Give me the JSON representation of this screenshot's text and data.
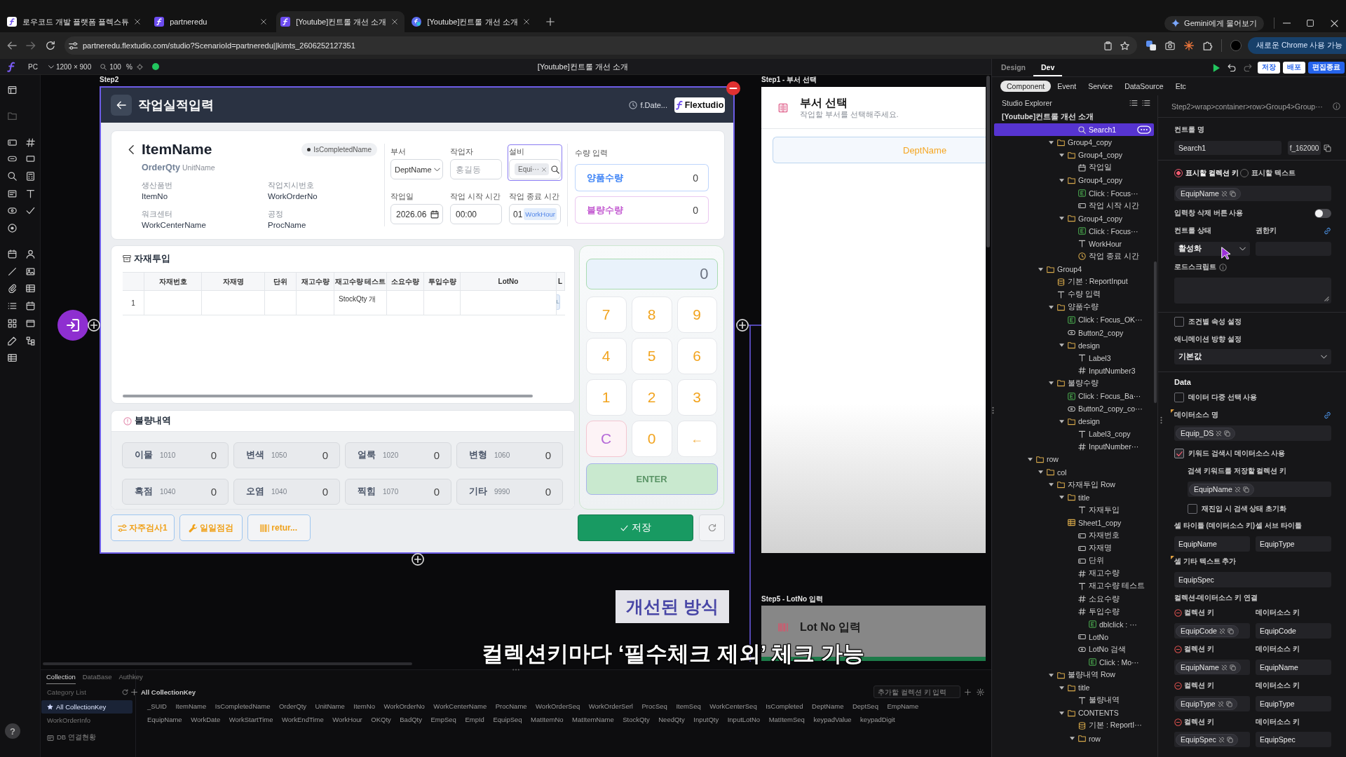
{
  "browser": {
    "tabs": [
      {
        "title": "로우코드 개발 플랫폼 플렉스튜",
        "selected": false
      },
      {
        "title": "partneredu",
        "selected": false
      },
      {
        "title": "[Youtube]컨트롤 개선 소개",
        "selected": true
      },
      {
        "title": "[Youtube]컨트롤 개선 소개",
        "selected": false
      }
    ],
    "assistant_button": "Gemini에게 물어보기",
    "url": "partneredu.flextudio.com/studio?ScenarioId=partneredu||kimts_2606252127351",
    "update_button": "새로운 Chrome 사용 가능"
  },
  "studio_toolbar": {
    "device": "PC",
    "resolution": "1200 × 900",
    "zoom": "100",
    "zoom_unit": "%",
    "title": "[Youtube]컨트롤 개선 소개"
  },
  "canvas": {
    "step2": {
      "label": "Step2",
      "header": {
        "title": "작업실적입력",
        "date": "f.Date...",
        "brand": "Flextudio"
      },
      "item": {
        "name": "ItemName",
        "quantity": "OrderQty",
        "unit": "UnitName",
        "status": "IsCompletedName",
        "details": [
          {
            "label": "생산품번",
            "value": "ItemNo"
          },
          {
            "label": "작업지시번호",
            "value": "WorkOrderNo"
          },
          {
            "label": "워크센터",
            "value": "WorkCenterName"
          },
          {
            "label": "공정",
            "value": "ProcName"
          }
        ]
      },
      "fields": [
        {
          "label": "부서",
          "kind": "select",
          "value": "DeptName",
          "selected": false
        },
        {
          "label": "작업자",
          "kind": "text",
          "placeholder": "홍길동",
          "selected": false
        },
        {
          "label": "설비",
          "kind": "search",
          "chip": "Equi···",
          "selected": true
        },
        {
          "label": "작업일",
          "kind": "date",
          "value": "2026.06",
          "selected": false
        },
        {
          "label": "작업 시작 시간",
          "kind": "text",
          "value": "00:00",
          "selected": false
        },
        {
          "label": "작업 종료 시간",
          "kind": "time",
          "value": "01",
          "tag": "WorkHour",
          "selected": false
        }
      ],
      "quantity": {
        "title": "수량 입력",
        "items": [
          {
            "label": "양품수량",
            "value": "0",
            "color": "#3b82f6"
          },
          {
            "label": "불량수량",
            "value": "0",
            "color": "#c35bd1"
          }
        ]
      },
      "materials": {
        "title": "자재투입",
        "columns": [
          "자재번호",
          "자재명",
          "단위",
          "재고수량",
          "재고수량 테스트",
          "소요수량",
          "투입수량",
          "LotNo",
          "L"
        ],
        "rows": [
          {
            "number": "1",
            "stock_test": "StockQty 개",
            "lot_search": "L"
          }
        ]
      },
      "defects": {
        "title": "불량내역",
        "items": [
          {
            "name": "이물",
            "code": "1010",
            "value": "0"
          },
          {
            "name": "변색",
            "code": "1050",
            "value": "0"
          },
          {
            "name": "얼룩",
            "code": "1020",
            "value": "0"
          },
          {
            "name": "변형",
            "code": "1060",
            "value": "0"
          },
          {
            "name": "흑점",
            "code": "1040",
            "value": "0"
          },
          {
            "name": "오염",
            "code": "1040",
            "value": "0"
          },
          {
            "name": "찍힘",
            "code": "1070",
            "value": "0"
          },
          {
            "name": "기타",
            "code": "9990",
            "value": "0"
          }
        ]
      },
      "keypad": {
        "display": "0",
        "keys": [
          {
            "label": "7",
            "kind": "digit"
          },
          {
            "label": "8",
            "kind": "digit"
          },
          {
            "label": "9",
            "kind": "digit"
          },
          {
            "label": "4",
            "kind": "digit"
          },
          {
            "label": "5",
            "kind": "digit"
          },
          {
            "label": "6",
            "kind": "digit"
          },
          {
            "label": "1",
            "kind": "digit"
          },
          {
            "label": "2",
            "kind": "digit"
          },
          {
            "label": "3",
            "kind": "digit"
          },
          {
            "label": "C",
            "kind": "clear"
          },
          {
            "label": "0",
            "kind": "digit"
          },
          {
            "label": "←",
            "kind": "backspace"
          }
        ],
        "enter": {
          "label": "ENTER",
          "disabled": true
        }
      },
      "actions": [
        {
          "label": "자주검사1",
          "kind": "inspection"
        },
        {
          "label": "일일점검",
          "kind": "maintenance"
        },
        {
          "label": "retur...",
          "kind": "barcode"
        }
      ],
      "save_button": "저장"
    },
    "step1": {
      "label": "Step1 - 부서 선택",
      "title": "부서 선택",
      "subtitle": "작업할 부서를 선택해주세요.",
      "option": "DeptName"
    },
    "step5": {
      "label": "Step5 - LotNo 입력",
      "title": "Lot No 입력"
    },
    "caption": {
      "tag": "개선된 방식",
      "text": "컬렉션키마다 ‘필수체크 제외’ 체크 가능"
    }
  },
  "bottom_panel": {
    "tabs": [
      {
        "label": "Collection",
        "selected": true
      },
      {
        "label": "DataBase",
        "selected": false
      },
      {
        "label": "Authkey",
        "selected": false
      }
    ],
    "category_placeholder": "Category List",
    "categories": [
      {
        "label": "All CollectionKey",
        "kind": "all",
        "selected": true
      },
      {
        "label": "WorkOrderInfo",
        "kind": "group",
        "selected": false
      }
    ],
    "db_status": "DB 연결현황",
    "heading": "All CollectionKey",
    "key_placeholder": "추가할 컬렉션 키 입력",
    "key_rows": [
      [
        "_SUID",
        "ItemName",
        "IsCompletedName",
        "OrderQty",
        "UnitName",
        "ItemNo",
        "WorkOrderNo",
        "WorkCenterName",
        "ProcName",
        "WorkOrderSeq",
        "WorkOrderSerl",
        "ProcSeq",
        "ItemSeq",
        "WorkCenterSeq",
        "IsCompleted",
        "DeptName",
        "DeptSeq",
        "EmpName"
      ],
      [
        "EquipName",
        "WorkDate",
        "WorkStartTime",
        "WorkEndTime",
        "WorkHour",
        "OKQty",
        "BadQty",
        "EmpSeq",
        "EmpId",
        "EquipSeq",
        "MatItemNo",
        "MatItemName",
        "StockQty",
        "NeedQty",
        "InputQty",
        "InputLotNo",
        "MatItemSeq",
        "keypadValue",
        "keypadDigit"
      ]
    ]
  },
  "help_button": "?",
  "right_panel": {
    "mode_tabs": [
      {
        "label": "Design",
        "selected": false
      },
      {
        "label": "Dev",
        "selected": true
      }
    ],
    "actions": [
      {
        "label": "저장",
        "kind": "default"
      },
      {
        "label": "배포",
        "kind": "default"
      },
      {
        "label": "편집종료",
        "kind": "primary"
      }
    ],
    "sub_tabs": [
      {
        "label": "Component",
        "selected": true
      },
      {
        "label": "Event",
        "selected": false
      },
      {
        "label": "Service",
        "selected": false
      },
      {
        "label": "DataSource",
        "selected": false
      },
      {
        "label": "Etc",
        "selected": false
      }
    ],
    "explorer": {
      "title": "Studio Explorer",
      "root": "[Youtube]컨트롤 개선 소개",
      "items": [
        {
          "children": [
            {
              "children": [
                {
                  "children": [
                    {
                      "children": [
                        {
                          "label": "Search1",
                          "kind": "search",
                          "selected": true
                        }
                      ]
                    }
                  ]
                },
                {
                  "label": "Group4_copy",
                  "kind": "folder",
                  "selected": false,
                  "expanded": true,
                  "children": [
                    {
                      "label": "Group4_copy",
                      "kind": "folder",
                      "selected": false,
                      "expanded": true,
                      "children": [
                        {
                          "label": "작업일",
                          "kind": "date",
                          "selected": false
                        }
                      ]
                    },
                    {
                      "label": "Group4_copy",
                      "kind": "folder",
                      "selected": false,
                      "expanded": true,
                      "children": [
                        {
                          "label": "Click : Focus···",
                          "kind": "event",
                          "selected": false
                        },
                        {
                          "label": "작업 시작 시간",
                          "kind": "input",
                          "selected": false
                        }
                      ]
                    },
                    {
                      "label": "Group4_copy",
                      "kind": "folder",
                      "selected": false,
                      "expanded": true,
                      "children": [
                        {
                          "label": "Click : Focus···",
                          "kind": "event",
                          "selected": false
                        },
                        {
                          "label": "WorkHour",
                          "kind": "text",
                          "selected": false
                        },
                        {
                          "label": "작업 종료 시간",
                          "kind": "time",
                          "selected": false
                        }
                      ]
                    }
                  ]
                }
              ]
            },
            {
              "label": "Group4",
              "kind": "folder",
              "selected": false,
              "expanded": true,
              "children": [
                {
                  "label": "기본 : ReportInput",
                  "kind": "database",
                  "selected": false
                },
                {
                  "label": "수량 입력",
                  "kind": "text",
                  "selected": false
                },
                {
                  "label": "양품수량",
                  "kind": "folder",
                  "selected": false,
                  "expanded": true,
                  "children": [
                    {
                      "label": "Click : Focus_OK···",
                      "kind": "event",
                      "selected": false
                    },
                    {
                      "label": "Button2_copy",
                      "kind": "button",
                      "selected": false
                    },
                    {
                      "label": "design",
                      "kind": "folder",
                      "selected": false,
                      "expanded": true,
                      "children": [
                        {
                          "label": "Label3",
                          "kind": "text",
                          "selected": false
                        },
                        {
                          "label": "InputNumber3",
                          "kind": "number",
                          "selected": false
                        }
                      ]
                    }
                  ]
                },
                {
                  "label": "불량수량",
                  "kind": "folder",
                  "selected": false,
                  "expanded": true,
                  "children": [
                    {
                      "label": "Click : Focus_Ba···",
                      "kind": "event",
                      "selected": false
                    },
                    {
                      "label": "Button2_copy_co···",
                      "kind": "button",
                      "selected": false
                    },
                    {
                      "label": "design",
                      "kind": "folder",
                      "selected": false,
                      "expanded": true,
                      "children": [
                        {
                          "label": "Label3_copy",
                          "kind": "text",
                          "selected": false
                        },
                        {
                          "label": "InputNumber···",
                          "kind": "number",
                          "selected": false
                        }
                      ]
                    }
                  ]
                }
              ]
            }
          ]
        },
        {
          "label": "row",
          "kind": "folder",
          "selected": false,
          "expanded": true,
          "children": [
            {
              "label": "col",
              "kind": "folder",
              "selected": false,
              "expanded": true,
              "children": [
                {
                  "label": "자재투입 Row",
                  "kind": "folder",
                  "selected": false,
                  "expanded": true,
                  "children": [
                    {
                      "label": "title",
                      "kind": "folder",
                      "selected": false,
                      "expanded": true,
                      "children": [
                        {
                          "label": "자재투입",
                          "kind": "text",
                          "selected": false
                        }
                      ]
                    },
                    {
                      "label": "Sheet1_copy",
                      "kind": "sheet",
                      "selected": false,
                      "children": [
                        {
                          "label": "자재번호",
                          "kind": "input",
                          "selected": false
                        },
                        {
                          "label": "자재명",
                          "kind": "input",
                          "selected": false
                        },
                        {
                          "label": "단위",
                          "kind": "input",
                          "selected": false
                        },
                        {
                          "label": "재고수량",
                          "kind": "number",
                          "selected": false
                        },
                        {
                          "label": "재고수량 테스트",
                          "kind": "text",
                          "selected": false
                        },
                        {
                          "label": "소요수량",
                          "kind": "number",
                          "selected": false
                        },
                        {
                          "label": "투입수량",
                          "kind": "number",
                          "selected": false,
                          "children": [
                            {
                              "label": "dblclick : ···",
                              "kind": "event",
                              "selected": false
                            }
                          ]
                        },
                        {
                          "label": "LotNo",
                          "kind": "input",
                          "selected": false
                        },
                        {
                          "label": "LotNo 검색",
                          "kind": "button",
                          "selected": false,
                          "children": [
                            {
                              "label": "Click : Mo···",
                              "kind": "event",
                              "selected": false
                            }
                          ]
                        }
                      ]
                    }
                  ]
                },
                {
                  "label": "불량내역 Row",
                  "kind": "folder",
                  "selected": false,
                  "expanded": true,
                  "children": [
                    {
                      "label": "title",
                      "kind": "folder",
                      "selected": false,
                      "expanded": true,
                      "children": [
                        {
                          "label": "불량내역",
                          "kind": "text",
                          "selected": false
                        }
                      ]
                    },
                    {
                      "label": "CONTENTS",
                      "kind": "folder",
                      "selected": false,
                      "expanded": true,
                      "children": [
                        {
                          "label": "기본 : ReportI···",
                          "kind": "database",
                          "selected": false
                        },
                        {
                          "label": "row",
                          "kind": "folder",
                          "selected": false,
                          "expanded": true
                        }
                      ]
                    }
                  ]
                }
              ]
            }
          ]
        }
      ]
    },
    "properties": {
      "breadcrumb": "Step2>wrap>container>row>Group4>Group···",
      "control_name": {
        "label": "컨트롤 명",
        "value": "Search1",
        "id": "f_162000"
      },
      "display_options": [
        {
          "label": "표시할 컬렉션 키",
          "selected": true
        },
        {
          "label": "표시할 텍스트",
          "selected": false
        }
      ],
      "display_key": "EquipName",
      "clear_button": {
        "label": "입력창 삭제 버튼 사용",
        "on": false
      },
      "state": {
        "label": "컨트롤 상태",
        "value": "활성화"
      },
      "permission_key": {
        "label": "권한키"
      },
      "load_script": {
        "label": "로드스크립트"
      },
      "conditional": {
        "label": "조건별 속성 설정",
        "checked": false
      },
      "animation": {
        "label": "애니메이션 방향 설정",
        "value": "기본값"
      },
      "data_section": "Data",
      "multi_select": {
        "label": "데이터 다중 선택 사용",
        "checked": false
      },
      "datasource": {
        "label": "데이터소스 명",
        "value": "Equip_DS",
        "flagged": true
      },
      "keyword_datasource": {
        "label": "키워드 검색시 데이터소스 사용",
        "checked": true
      },
      "keyword_key": {
        "label": "검색 키워드를 저장할 컬렉션 키",
        "value": "EquipName"
      },
      "reset_on_reentry": {
        "label": "재진입 시 검색 상태 초기화",
        "checked": false
      },
      "cell_title": {
        "label": "셀 타이틀 (데이터소스 키)",
        "value": "EquipName"
      },
      "cell_subtitle": {
        "label": "셀 서브 타이틀",
        "value": "EquipType"
      },
      "cell_extra": {
        "label": "셀 기타 텍스트 추가",
        "value": "EquipSpec",
        "flagged": true
      },
      "key_mapping": {
        "title": "컬렉션-데이터소스 키 연결",
        "rows": [
          {
            "collection_label": "컬렉션 키",
            "collection_key": "EquipCode",
            "datasource_label": "데이터소스 키",
            "datasource_key": "EquipCode"
          },
          {
            "collection_label": "컬렉션 키",
            "collection_key": "EquipName",
            "datasource_label": "데이터소스 키",
            "datasource_key": "EquipName"
          },
          {
            "collection_label": "컬렉션 키",
            "collection_key": "EquipType",
            "datasource_label": "데이터소스 키",
            "datasource_key": "EquipType"
          },
          {
            "collection_label": "컬렉션 키",
            "collection_key": "EquipSpec",
            "datasource_label": "데이터소스 키",
            "datasource_key": "EquipSpec"
          }
        ]
      }
    }
  }
}
